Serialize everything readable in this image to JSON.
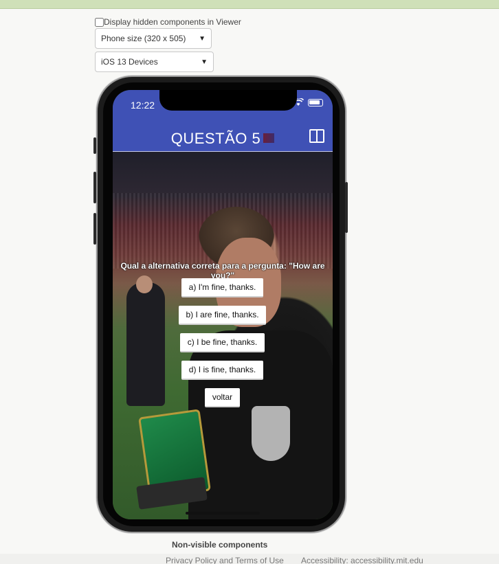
{
  "viewer": {
    "hidden_components_label": "Display hidden components in Viewer",
    "phone_size": "Phone size (320 x 505)",
    "device_theme": "iOS 13 Devices"
  },
  "phone": {
    "status_time": "12:22",
    "title": "QUESTÃO 5",
    "question": "Qual a alternativa correta para a pergunta: \"How are you?\"",
    "answers": [
      "a) I'm fine, thanks.",
      "b) I are fine, thanks.",
      "c) I be fine, thanks.",
      "d) I is fine, thanks."
    ],
    "back_label": "voltar"
  },
  "non_visible_label": "Non-visible components",
  "footer": {
    "privacy": "Privacy Policy and Terms of Use",
    "accessibility": "Accessibility: accessibility.mit.edu"
  },
  "colors": {
    "app_bar": "#3f51b5",
    "top_band": "#cfe0b8"
  },
  "icons": [
    "wifi-icon",
    "battery-icon",
    "book-icon",
    "flag-icon",
    "chevron-down-icon"
  ]
}
